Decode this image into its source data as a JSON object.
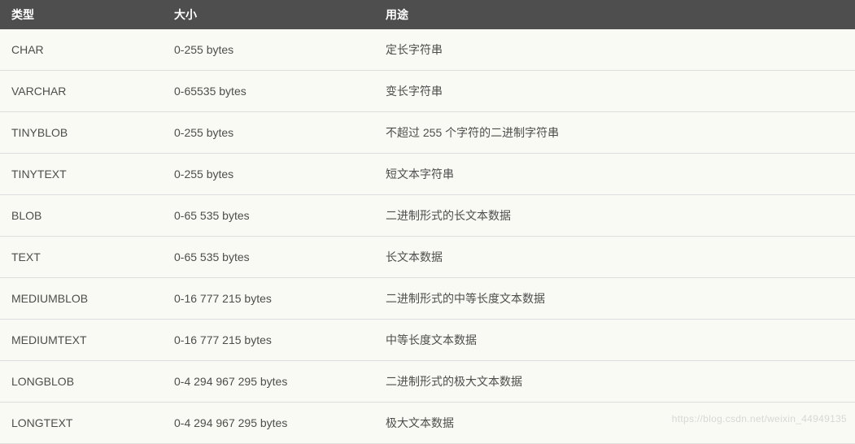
{
  "table": {
    "headers": {
      "type": "类型",
      "size": "大小",
      "usage": "用途"
    },
    "rows": [
      {
        "type": "CHAR",
        "size": "0-255 bytes",
        "usage": "定长字符串"
      },
      {
        "type": "VARCHAR",
        "size": "0-65535 bytes",
        "usage": "变长字符串"
      },
      {
        "type": "TINYBLOB",
        "size": "0-255 bytes",
        "usage": "不超过 255 个字符的二进制字符串"
      },
      {
        "type": "TINYTEXT",
        "size": "0-255 bytes",
        "usage": "短文本字符串"
      },
      {
        "type": "BLOB",
        "size": "0-65 535 bytes",
        "usage": "二进制形式的长文本数据"
      },
      {
        "type": "TEXT",
        "size": "0-65 535 bytes",
        "usage": "长文本数据"
      },
      {
        "type": "MEDIUMBLOB",
        "size": "0-16 777 215 bytes",
        "usage": "二进制形式的中等长度文本数据"
      },
      {
        "type": "MEDIUMTEXT",
        "size": "0-16 777 215 bytes",
        "usage": "中等长度文本数据"
      },
      {
        "type": "LONGBLOB",
        "size": "0-4 294 967 295 bytes",
        "usage": "二进制形式的极大文本数据"
      },
      {
        "type": "LONGTEXT",
        "size": "0-4 294 967 295 bytes",
        "usage": "极大文本数据"
      }
    ]
  },
  "watermark": "https://blog.csdn.net/weixin_44949135"
}
